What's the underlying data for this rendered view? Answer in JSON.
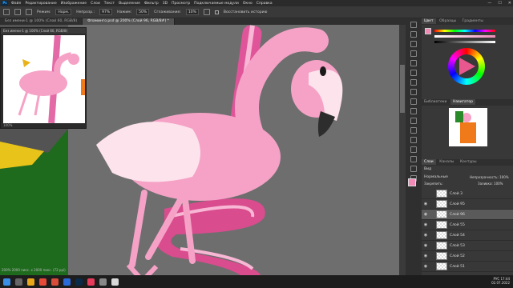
{
  "menu": {
    "items": [
      "Файл",
      "Редактирование",
      "Изображение",
      "Слои",
      "Текст",
      "Выделение",
      "Фильтр",
      "3D",
      "Просмотр",
      "Подключаемые модули",
      "Окно",
      "Справка"
    ]
  },
  "options": {
    "mode_label": "Режим:",
    "mode_value": "Норм.",
    "opacity_label": "Непрозр.:",
    "opacity_value": "97%",
    "flow_label": "Нажим:",
    "flow_value": "50%",
    "smooth_label": "Сглаживание:",
    "smooth_value": "10%",
    "restore_label": "Восстановить историю"
  },
  "tabs": [
    {
      "label": "Фламинго.psd @ 200% (Слой 96, RGB/8#) *"
    }
  ],
  "float_doc": {
    "title": "Без имени-1 @ 100% (Слой 60, RGB/8)",
    "zoom": "100%"
  },
  "statusbar": {
    "text": "200%  2000 пикс. x 2000 пикс. (72 ppi)"
  },
  "panels": {
    "color_tabs": [
      "Цвет",
      "Образцы",
      "Градиенты"
    ],
    "nav_tabs": [
      "Библиотеки",
      "Навигатор"
    ],
    "layers_tabs": [
      "Слои",
      "Каналы",
      "Контуры"
    ],
    "kind_label": "Вид",
    "blend_label": "Нормальные",
    "opacity_label": "Непрозрачность:",
    "opacity_value": "100%",
    "lock_label": "Закрепить:",
    "fill_label": "Заливка:",
    "fill_value": "100%",
    "layers": [
      {
        "name": "Слой 3",
        "visible": false
      },
      {
        "name": "Слой 95",
        "visible": true
      },
      {
        "name": "Слой 96",
        "visible": true,
        "selected": true
      },
      {
        "name": "Слой 55",
        "visible": true
      },
      {
        "name": "Слой 54",
        "visible": true
      },
      {
        "name": "Слой 53",
        "visible": true
      },
      {
        "name": "Слой 52",
        "visible": true
      },
      {
        "name": "Слой 51",
        "visible": true
      }
    ]
  },
  "taskbar": {
    "time": "17:44",
    "date": "02.07.2022",
    "lang": "РУС"
  },
  "colors": {
    "fg": "#f08ab7",
    "bg": "#ffffff",
    "pink": "#f5a2c6",
    "beak": "#2d2d2d"
  }
}
